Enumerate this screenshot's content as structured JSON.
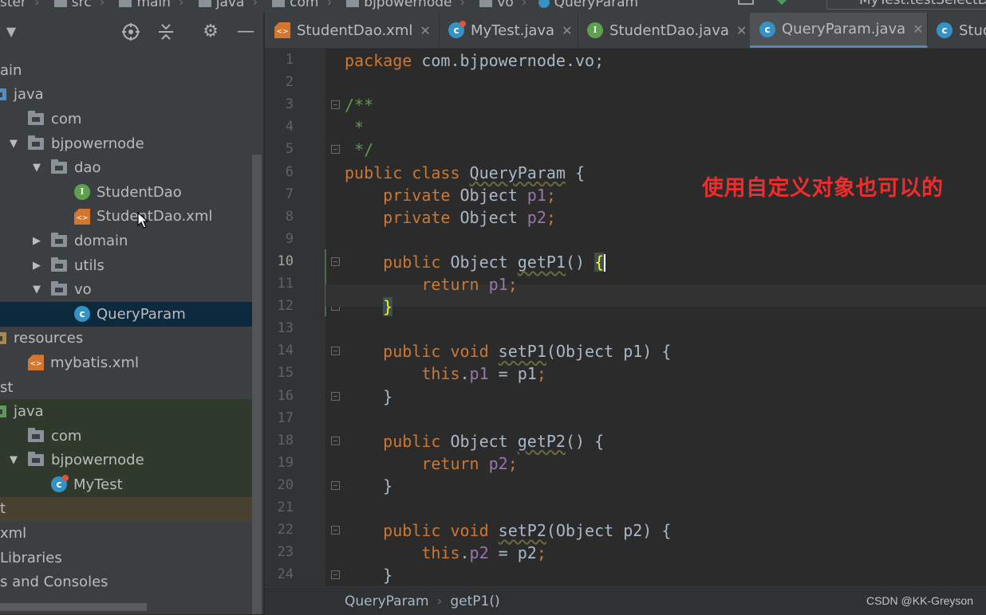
{
  "breadcrumb": {
    "items": [
      {
        "label": "ster",
        "icon": "project-icon"
      },
      {
        "label": "src",
        "icon": "folder-icon"
      },
      {
        "label": "main",
        "icon": "folder-icon"
      },
      {
        "label": "java",
        "icon": "folder-icon"
      },
      {
        "label": "com",
        "icon": "folder-icon"
      },
      {
        "label": "bjpowernode",
        "icon": "folder-icon"
      },
      {
        "label": "vo",
        "icon": "folder-icon"
      },
      {
        "label": "QueryParam",
        "icon": "class-icon"
      }
    ],
    "run_config": "MyTest.testSelectDOb"
  },
  "project_panel": {
    "toolbar_icons": [
      "dropdown-icon",
      "locate-icon",
      "collapse-all-icon",
      "gear-icon",
      "hide-icon"
    ],
    "tree": [
      {
        "label": "ain",
        "indent": 0,
        "arrow": "",
        "icon": "none",
        "state": "normal"
      },
      {
        "label": "java",
        "indent": 0,
        "arrow": "",
        "icon": "source-folder",
        "state": "normal"
      },
      {
        "label": "com",
        "indent": 1,
        "arrow": "",
        "icon": "package",
        "state": "normal"
      },
      {
        "label": "bjpowernode",
        "indent": 1,
        "arrow": "▼",
        "icon": "package",
        "state": "normal"
      },
      {
        "label": "dao",
        "indent": 2,
        "arrow": "▼",
        "icon": "package",
        "state": "normal"
      },
      {
        "label": "StudentDao",
        "indent": 3,
        "arrow": "",
        "icon": "interface",
        "state": "normal"
      },
      {
        "label": "StudentDao.xml",
        "indent": 3,
        "arrow": "",
        "icon": "xml",
        "state": "normal"
      },
      {
        "label": "domain",
        "indent": 2,
        "arrow": "▶",
        "icon": "package",
        "state": "normal"
      },
      {
        "label": "utils",
        "indent": 2,
        "arrow": "▶",
        "icon": "package",
        "state": "normal"
      },
      {
        "label": "vo",
        "indent": 2,
        "arrow": "▼",
        "icon": "package",
        "state": "normal"
      },
      {
        "label": "QueryParam",
        "indent": 3,
        "arrow": "",
        "icon": "class",
        "state": "selected"
      },
      {
        "label": "resources",
        "indent": 0,
        "arrow": "",
        "icon": "resource-folder",
        "state": "normal"
      },
      {
        "label": "mybatis.xml",
        "indent": 1,
        "arrow": "",
        "icon": "xml",
        "state": "normal"
      },
      {
        "label": "st",
        "indent": 0,
        "arrow": "",
        "icon": "none",
        "state": "normal"
      },
      {
        "label": "java",
        "indent": 0,
        "arrow": "",
        "icon": "test-folder",
        "state": "test"
      },
      {
        "label": "com",
        "indent": 1,
        "arrow": "",
        "icon": "package",
        "state": "test"
      },
      {
        "label": "bjpowernode",
        "indent": 1,
        "arrow": "▼",
        "icon": "package",
        "state": "test"
      },
      {
        "label": "MyTest",
        "indent": 2,
        "arrow": "",
        "icon": "test-class",
        "state": "test"
      },
      {
        "label": "t",
        "indent": 0,
        "arrow": "",
        "icon": "none",
        "state": "excluded"
      },
      {
        "label": "xml",
        "indent": 0,
        "arrow": "",
        "icon": "none",
        "state": "normal"
      },
      {
        "label": "Libraries",
        "indent": 0,
        "arrow": "",
        "icon": "none",
        "state": "normal"
      },
      {
        "label": "s and Consoles",
        "indent": 0,
        "arrow": "",
        "icon": "none",
        "state": "normal"
      }
    ]
  },
  "editor": {
    "tabs": [
      {
        "label": "StudentDao.xml",
        "icon": "xml",
        "active": false,
        "closable": true
      },
      {
        "label": "MyTest.java",
        "icon": "test-class",
        "active": false,
        "closable": true
      },
      {
        "label": "StudentDao.java",
        "icon": "interface",
        "active": false,
        "closable": true
      },
      {
        "label": "QueryParam.java",
        "icon": "class",
        "active": true,
        "closable": true
      },
      {
        "label": "Stud",
        "icon": "class",
        "active": false,
        "closable": false
      }
    ],
    "current_line": 10,
    "fold_lines": [
      3,
      5,
      10,
      12,
      14,
      16,
      18,
      20,
      22,
      24
    ],
    "lines": [
      [
        [
          "kw",
          "package "
        ],
        [
          "p",
          "com.bjpowernode.vo;"
        ]
      ],
      [],
      [
        [
          "cm",
          "/**"
        ]
      ],
      [
        [
          "cm",
          " *"
        ]
      ],
      [
        [
          "cm",
          " */"
        ]
      ],
      [
        [
          "kw",
          "public class "
        ],
        [
          "mt",
          "QueryParam"
        ],
        [
          "p",
          " {"
        ]
      ],
      [
        [
          "p",
          "    "
        ],
        [
          "kw",
          "private "
        ],
        [
          "p",
          "Object "
        ],
        [
          "fld",
          "p1"
        ],
        [
          "kw",
          ";"
        ]
      ],
      [
        [
          "p",
          "    "
        ],
        [
          "kw",
          "private "
        ],
        [
          "p",
          "Object "
        ],
        [
          "fld",
          "p2"
        ],
        [
          "kw",
          ";"
        ]
      ],
      [],
      [
        [
          "p",
          "    "
        ],
        [
          "kw",
          "public "
        ],
        [
          "p",
          "Object "
        ],
        [
          "mt",
          "getP1"
        ],
        [
          "p",
          "() "
        ],
        [
          "brk",
          "{"
        ],
        [
          "caret",
          ""
        ]
      ],
      [
        [
          "p",
          "        "
        ],
        [
          "kw",
          "return "
        ],
        [
          "fld",
          "p1"
        ],
        [
          "kw",
          ";"
        ]
      ],
      [
        [
          "p",
          "    "
        ],
        [
          "brk",
          "}"
        ]
      ],
      [],
      [
        [
          "p",
          "    "
        ],
        [
          "kw",
          "public void "
        ],
        [
          "mt",
          "setP1"
        ],
        [
          "p",
          "(Object p1) {"
        ]
      ],
      [
        [
          "p",
          "        "
        ],
        [
          "kw",
          "this"
        ],
        [
          "p",
          "."
        ],
        [
          "fld",
          "p1"
        ],
        [
          "p",
          " = p1"
        ],
        [
          "kw",
          ";"
        ]
      ],
      [
        [
          "p",
          "    }"
        ]
      ],
      [],
      [
        [
          "p",
          "    "
        ],
        [
          "kw",
          "public "
        ],
        [
          "p",
          "Object "
        ],
        [
          "mt",
          "getP2"
        ],
        [
          "p",
          "() {"
        ]
      ],
      [
        [
          "p",
          "        "
        ],
        [
          "kw",
          "return "
        ],
        [
          "fld",
          "p2"
        ],
        [
          "kw",
          ";"
        ]
      ],
      [
        [
          "p",
          "    }"
        ]
      ],
      [],
      [
        [
          "p",
          "    "
        ],
        [
          "kw",
          "public void "
        ],
        [
          "mt",
          "setP2"
        ],
        [
          "p",
          "(Object p2) {"
        ]
      ],
      [
        [
          "p",
          "        "
        ],
        [
          "kw",
          "this"
        ],
        [
          "p",
          "."
        ],
        [
          "fld",
          "p2"
        ],
        [
          "p",
          " = p2"
        ],
        [
          "kw",
          ";"
        ]
      ],
      [
        [
          "p",
          "    }"
        ]
      ]
    ],
    "annotation": "使用自定义对象也可以的",
    "status_breadcrumb": [
      "QueryParam",
      "getP1()"
    ],
    "watermark": "CSDN @KK-Greyson"
  },
  "colors": {
    "keyword": "#cc7832",
    "comment": "#629755",
    "field": "#9876aa",
    "plain": "#a9b7c6",
    "annotation": "#f02c2c",
    "selection": "#0d293e"
  }
}
